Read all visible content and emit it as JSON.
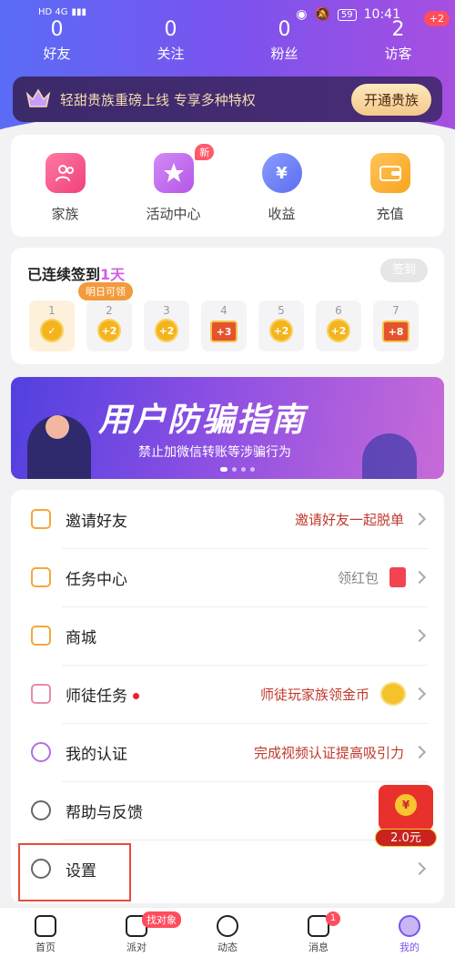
{
  "status_bar": {
    "left": "HD 4G",
    "battery": "59",
    "time": "10:41"
  },
  "stats": [
    {
      "num": "0",
      "label": "好友"
    },
    {
      "num": "0",
      "label": "关注"
    },
    {
      "num": "0",
      "label": "粉丝"
    },
    {
      "num": "2",
      "label": "访客"
    }
  ],
  "visitor_badge": "+2",
  "vip": {
    "text": "轻甜贵族重磅上线 专享多种特权",
    "button": "开通贵族"
  },
  "quick": [
    {
      "label": "家族",
      "color": "#f0407a"
    },
    {
      "label": "活动中心",
      "color": "#b457e8",
      "badge": "新"
    },
    {
      "label": "收益",
      "color": "#5b6ef0"
    },
    {
      "label": "充值",
      "color": "#f7a51e"
    }
  ],
  "sign": {
    "title_prefix": "已连续签到",
    "title_days": "1天",
    "button": "签到",
    "tomorrow_tag": "明日可领",
    "days": [
      {
        "n": "1",
        "reward": ""
      },
      {
        "n": "2",
        "reward": "+2"
      },
      {
        "n": "3",
        "reward": "+2"
      },
      {
        "n": "4",
        "reward": "+3"
      },
      {
        "n": "5",
        "reward": "+2"
      },
      {
        "n": "6",
        "reward": "+2"
      },
      {
        "n": "7",
        "reward": "+8"
      }
    ]
  },
  "banner": {
    "title": "用户防骗指南",
    "subtitle": "禁止加微信转账等涉骗行为"
  },
  "menu": [
    {
      "label": "邀请好友",
      "extra": "邀请好友一起脱单",
      "extra_color": "#c0392b",
      "icon_color": "#f2a93b"
    },
    {
      "label": "任务中心",
      "extra": "领红包",
      "extra_color": "#888888",
      "icon_color": "#f2a93b"
    },
    {
      "label": "商城",
      "extra": "",
      "extra_color": "#888888",
      "icon_color": "#f2a93b"
    },
    {
      "label": "师徒任务",
      "extra": "师徒玩家族领金币",
      "extra_color": "#c0392b",
      "icon_color": "#e889b0"
    },
    {
      "label": "我的认证",
      "extra": "完成视频认证提高吸引力",
      "extra_color": "#c0392b",
      "icon_color": "#b06fe6"
    },
    {
      "label": "帮助与反馈",
      "extra": "",
      "extra_color": "#888888",
      "icon_color": "#666666"
    },
    {
      "label": "设置",
      "extra": "",
      "extra_color": "#888888",
      "icon_color": "#666666"
    }
  ],
  "float_pack": {
    "coin": "¥",
    "amount": "2.0元"
  },
  "tabs": [
    {
      "label": "首页"
    },
    {
      "label": "派对",
      "badge": "找对象"
    },
    {
      "label": "动态"
    },
    {
      "label": "消息",
      "badge": "1"
    },
    {
      "label": "我的"
    }
  ]
}
